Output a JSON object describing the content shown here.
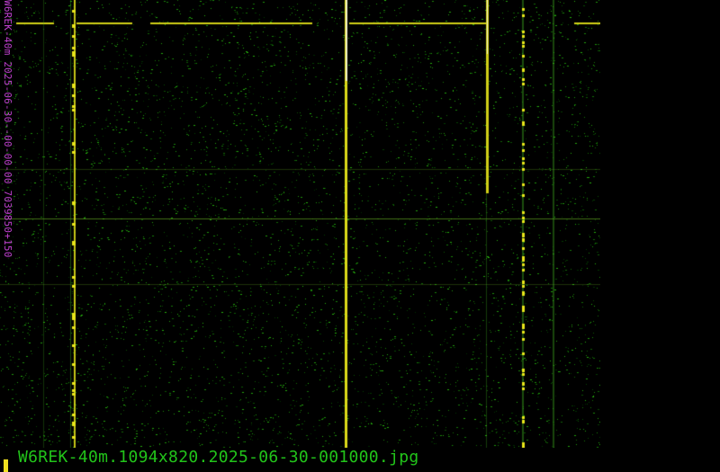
{
  "image": {
    "filename": "W6REK-40m.1094x820.2025-06-30-001000.jpg",
    "side_stamp": "W6REK-40m 2025-06-30--00-00-00 7039850+150"
  },
  "colors": {
    "background": "#000000",
    "noise_green": "#3fae1f",
    "signal_yellow": "#e8e61a",
    "signal_white": "#f4f4d8",
    "stamp_magenta": "#c040d0",
    "filename_green": "#22c41a",
    "cursor_yellow": "#f0e020"
  }
}
